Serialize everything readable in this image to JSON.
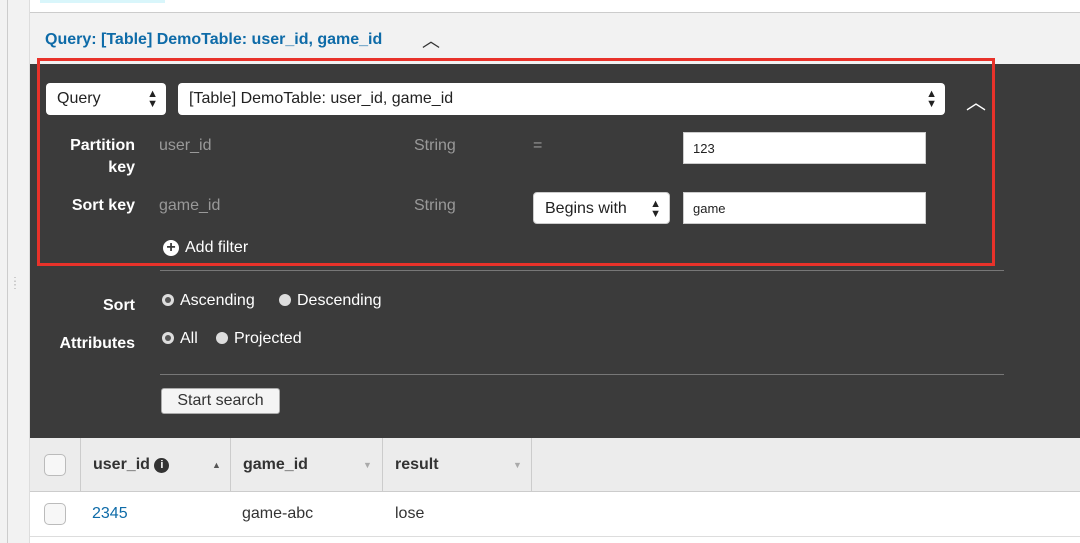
{
  "header": {
    "title": "Query: [Table] DemoTable: user_id, game_id"
  },
  "query": {
    "mode": "Query",
    "index": "[Table] DemoTable: user_id, game_id",
    "partition_key": {
      "label": "Partition key",
      "name": "user_id",
      "type": "String",
      "operator": "=",
      "value": "123"
    },
    "sort_key": {
      "label": "Sort key",
      "name": "game_id",
      "type": "String",
      "operator": "Begins with",
      "value": "game"
    },
    "add_filter": "Add filter",
    "sort": {
      "label": "Sort",
      "options": [
        "Ascending",
        "Descending"
      ],
      "selected": "Ascending"
    },
    "attributes": {
      "label": "Attributes",
      "options": [
        "All",
        "Projected"
      ],
      "selected": "All"
    },
    "start_search": "Start search"
  },
  "table": {
    "columns": [
      "user_id",
      "game_id",
      "result"
    ],
    "rows": [
      {
        "user_id": "2345",
        "game_id": "game-abc",
        "result": "lose"
      }
    ]
  },
  "colors": {
    "link": "#0e6ba8",
    "highlight": "#e8322a",
    "panel": "#3b3b3b"
  }
}
